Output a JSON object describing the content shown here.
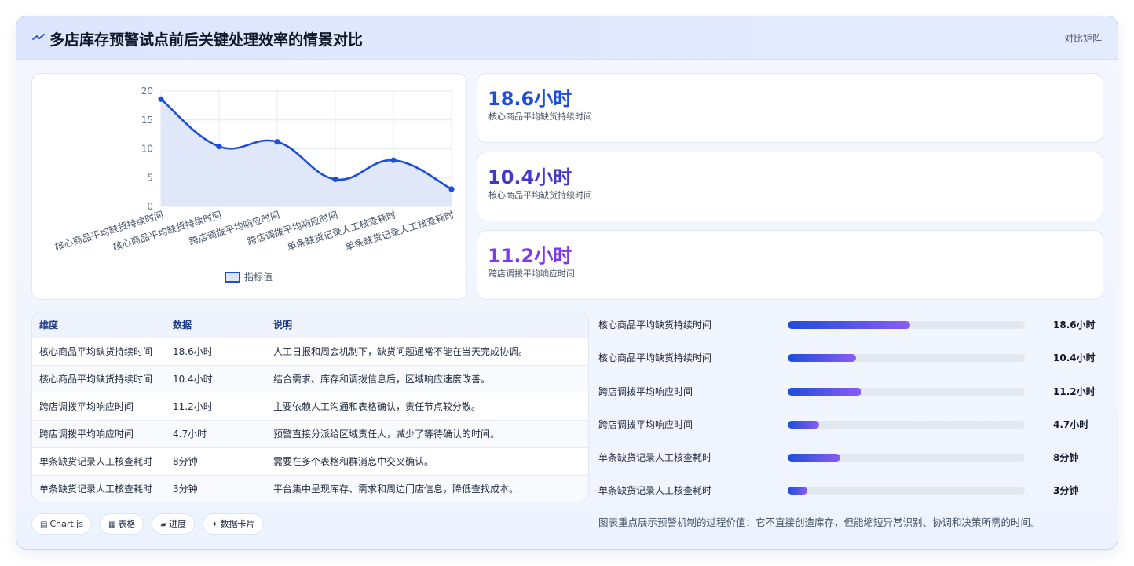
{
  "header": {
    "title": "多店库存预警试点前后关键处理效率的情景对比",
    "tag": "对比矩阵",
    "icon": "pulse-icon"
  },
  "chart_data": {
    "type": "line",
    "categories": [
      "核心商品平均缺货持续时间",
      "核心商品平均缺货持续时间",
      "跨店调拨平均响应时间",
      "跨店调拨平均响应时间",
      "单条缺货记录人工核查耗时",
      "单条缺货记录人工核查耗时"
    ],
    "series": [
      {
        "name": "指标值",
        "values": [
          18.6,
          10.4,
          11.2,
          4.7,
          8,
          3
        ]
      }
    ],
    "yticks": [
      "0",
      "5",
      "10",
      "15",
      "20"
    ],
    "ylim": [
      0,
      20
    ],
    "grid": true,
    "legend": "bottom",
    "fill": "area",
    "colors": {
      "line": "#1d4ed8",
      "area": "#dde4f8"
    }
  },
  "stats": [
    {
      "value": "18.6小时",
      "label": "核心商品平均缺货持续时间",
      "color": "#1d4ed8"
    },
    {
      "value": "10.4小时",
      "label": "核心商品平均缺货持续时间",
      "color": "#4338ca"
    },
    {
      "value": "11.2小时",
      "label": "跨店调拨平均响应时间",
      "color": "#7c3aed"
    }
  ],
  "table": {
    "headers": [
      "维度",
      "数据",
      "说明"
    ],
    "rows": [
      [
        "核心商品平均缺货持续时间",
        "18.6小时",
        "人工日报和周会机制下，缺货问题通常不能在当天完成协调。"
      ],
      [
        "核心商品平均缺货持续时间",
        "10.4小时",
        "结合需求、库存和调拨信息后，区域响应速度改善。"
      ],
      [
        "跨店调拨平均响应时间",
        "11.2小时",
        "主要依赖人工沟通和表格确认，责任节点较分散。"
      ],
      [
        "跨店调拨平均响应时间",
        "4.7小时",
        "预警直接分派给区域责任人，减少了等待确认的时间。"
      ],
      [
        "单条缺货记录人工核查耗时",
        "8分钟",
        "需要在多个表格和群消息中交叉确认。"
      ],
      [
        "单条缺货记录人工核查耗时",
        "3分钟",
        "平台集中呈现库存、需求和周边门店信息，降低查找成本。"
      ]
    ]
  },
  "bars": [
    {
      "label": "核心商品平均缺货持续时间",
      "value": "18.6小时",
      "fraction": 0.516
    },
    {
      "label": "核心商品平均缺货持续时间",
      "value": "10.4小时",
      "fraction": 0.289
    },
    {
      "label": "跨店调拨平均响应时间",
      "value": "11.2小时",
      "fraction": 0.311
    },
    {
      "label": "跨店调拨平均响应时间",
      "value": "4.7小时",
      "fraction": 0.131
    },
    {
      "label": "单条缺货记录人工核查耗时",
      "value": "8分钟",
      "fraction": 0.222
    },
    {
      "label": "单条缺货记录人工核查耗时",
      "value": "3分钟",
      "fraction": 0.083
    }
  ],
  "note": "图表重点展示预警机制的过程价值：它不直接创造库存，但能缩短异常识别、协调和决策所需的时间。",
  "chips": [
    {
      "icon": "chart-icon",
      "glyph": "▤",
      "label": "Chart.js"
    },
    {
      "icon": "table-icon",
      "glyph": "▦",
      "label": "表格"
    },
    {
      "icon": "progress-icon",
      "glyph": "▰",
      "label": "进度"
    },
    {
      "icon": "sparkle-icon",
      "glyph": "✦",
      "label": "数据卡片"
    }
  ]
}
